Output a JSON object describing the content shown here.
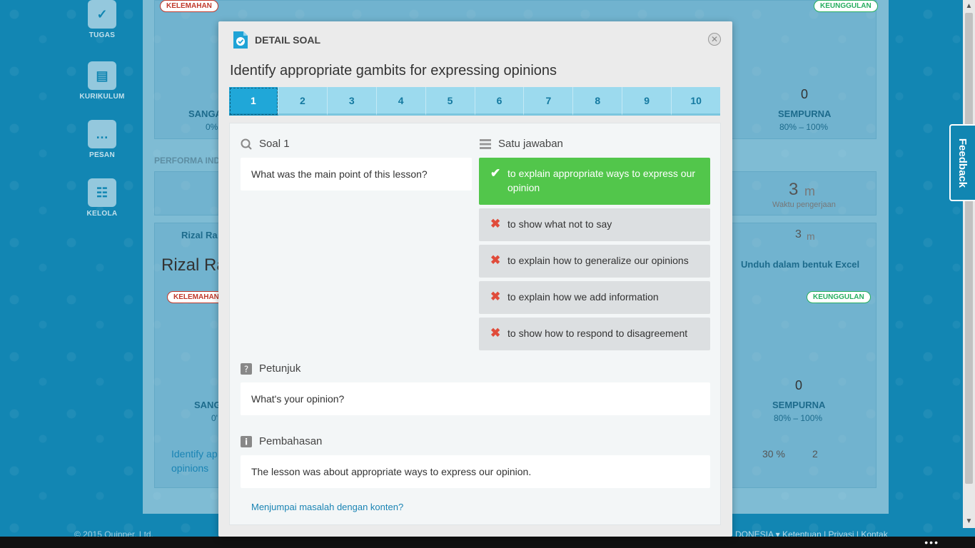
{
  "nav": {
    "items": [
      {
        "label": "TUGAS",
        "icon": "tasks-icon"
      },
      {
        "label": "KURIKULUM",
        "icon": "book-icon"
      },
      {
        "label": "PESAN",
        "icon": "chat-icon"
      },
      {
        "label": "KELOLA",
        "icon": "users-icon"
      }
    ]
  },
  "background": {
    "tag_weak": "KELEMAHAN",
    "tag_strong": "KEUNGGULAN",
    "top_count": "0",
    "top_sempurna": "SEMPURNA",
    "top_range": "80% – 100%",
    "top_sanga": "SANGA",
    "top_zero_pct": "0%",
    "performa": "PERFORMA INDI",
    "time_value": "3",
    "time_unit": "m",
    "time_label": "Waktu pengerjaan",
    "student_name_short": "Rizal Ra",
    "student_name_large": "Rizal Ra",
    "student_time": "3",
    "student_time_unit": "m",
    "excel_button": "Unduh dalam bentuk Excel",
    "bottom_count": "0",
    "bottom_sempurna": "SEMPURNA",
    "bottom_range": "80% – 100%",
    "bottom_sang": "SANG",
    "bottom_zero": "0'",
    "assign_title": "Identify ap",
    "assign_title2": "opinions",
    "percent": "30 %",
    "retries": "2"
  },
  "footer": {
    "copyright": "© 2015 Quipper, Ltd.",
    "right_links": "DONESIA ▾   Ketentuan | Privasi | Kontak",
    "dots": "•••"
  },
  "feedback": {
    "label": "Feedback"
  },
  "modal": {
    "header": "DETAIL SOAL",
    "close": "✕",
    "title": "Identify appropriate gambits for expressing opinions",
    "tabs": [
      "1",
      "2",
      "3",
      "4",
      "5",
      "6",
      "7",
      "8",
      "9",
      "10"
    ],
    "active_tab": "1",
    "question_label": "Soal 1",
    "question_text": "What was the main point of this lesson?",
    "answer_type": "Satu jawaban",
    "answers": [
      {
        "text": "to explain appropriate ways to express our opinion",
        "correct": true
      },
      {
        "text": "to show what not to say",
        "correct": false
      },
      {
        "text": "to explain how to generalize our opinions",
        "correct": false
      },
      {
        "text": "to explain how we add information",
        "correct": false
      },
      {
        "text": "to show how to respond to disagreement",
        "correct": false
      }
    ],
    "hint_label": "Petunjuk",
    "hint_text": "What's your opinion?",
    "explanation_label": "Pembahasan",
    "explanation_text": "The lesson was about appropriate ways to express our opinion.",
    "report_link": "Menjumpai masalah dengan konten?"
  },
  "colors": {
    "correct": "#52c64b",
    "wrong_mark": "#e04b3a",
    "tab": "#9cdaee",
    "tab_active": "#20a7d8"
  }
}
